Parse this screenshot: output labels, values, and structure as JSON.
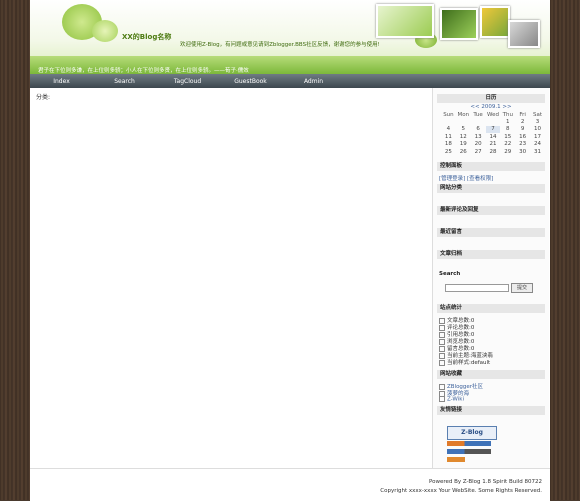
{
  "header": {
    "title": "XX的Blog名称",
    "subtitle": "欢迎使用Z-Blog，有问题或意见请到Zblogger.BBS社区反馈，谢谢您的参与使用!",
    "marquee": "君子在下位则多谦，在上位则多骄；小人在下位则多贤，在上位则多骄。——荀子·儒效"
  },
  "nav": [
    "Index",
    "Search",
    "TagCloud",
    "GuestBook",
    "Admin"
  ],
  "content": {
    "crumb": "分类:"
  },
  "sidebar": {
    "calendar": {
      "title": "日历",
      "month": "<< 2009.1 >>",
      "weekdays": [
        "Sun",
        "Mon",
        "Tue",
        "Wed",
        "Thu",
        "Fri",
        "Sat"
      ],
      "weeks": [
        [
          "",
          "",
          "",
          "",
          "1",
          "2",
          "3"
        ],
        [
          "4",
          "5",
          "6",
          "7",
          "8",
          "9",
          "10"
        ],
        [
          "11",
          "12",
          "13",
          "14",
          "15",
          "16",
          "17"
        ],
        [
          "18",
          "19",
          "20",
          "21",
          "22",
          "23",
          "24"
        ],
        [
          "25",
          "26",
          "27",
          "28",
          "29",
          "30",
          "31"
        ]
      ]
    },
    "panel": {
      "title": "控制面板",
      "links": "[管理登录] [查看权限]"
    },
    "categories": {
      "title": "网站分类"
    },
    "recent": {
      "title": "最新评论及回复"
    },
    "guestbook": {
      "title": "最近留言"
    },
    "archives": {
      "title": "文章归档"
    },
    "search": {
      "title": "Search",
      "button": "提交"
    },
    "stats": {
      "title": "站点统计",
      "items": [
        "文章总数:0",
        "评论总数:0",
        "引用总数:0",
        "浏览总数:0",
        "留言总数:0",
        "当前主题:海蓝泱翡",
        "当前样式:default"
      ]
    },
    "favorites": {
      "title": "网站收藏",
      "items": [
        "ZBlogger社区",
        "菠萝的海",
        "Z-Wiki"
      ]
    },
    "links": {
      "title": "友情链接",
      "badge_main": "Z-Blog"
    }
  },
  "footer": {
    "powered": "Powered By Z-Blog 1.8 Spirit Build 80722",
    "copyright": "Copyright xxxx-xxxx Your WebSite. Some Rights Reserved."
  }
}
